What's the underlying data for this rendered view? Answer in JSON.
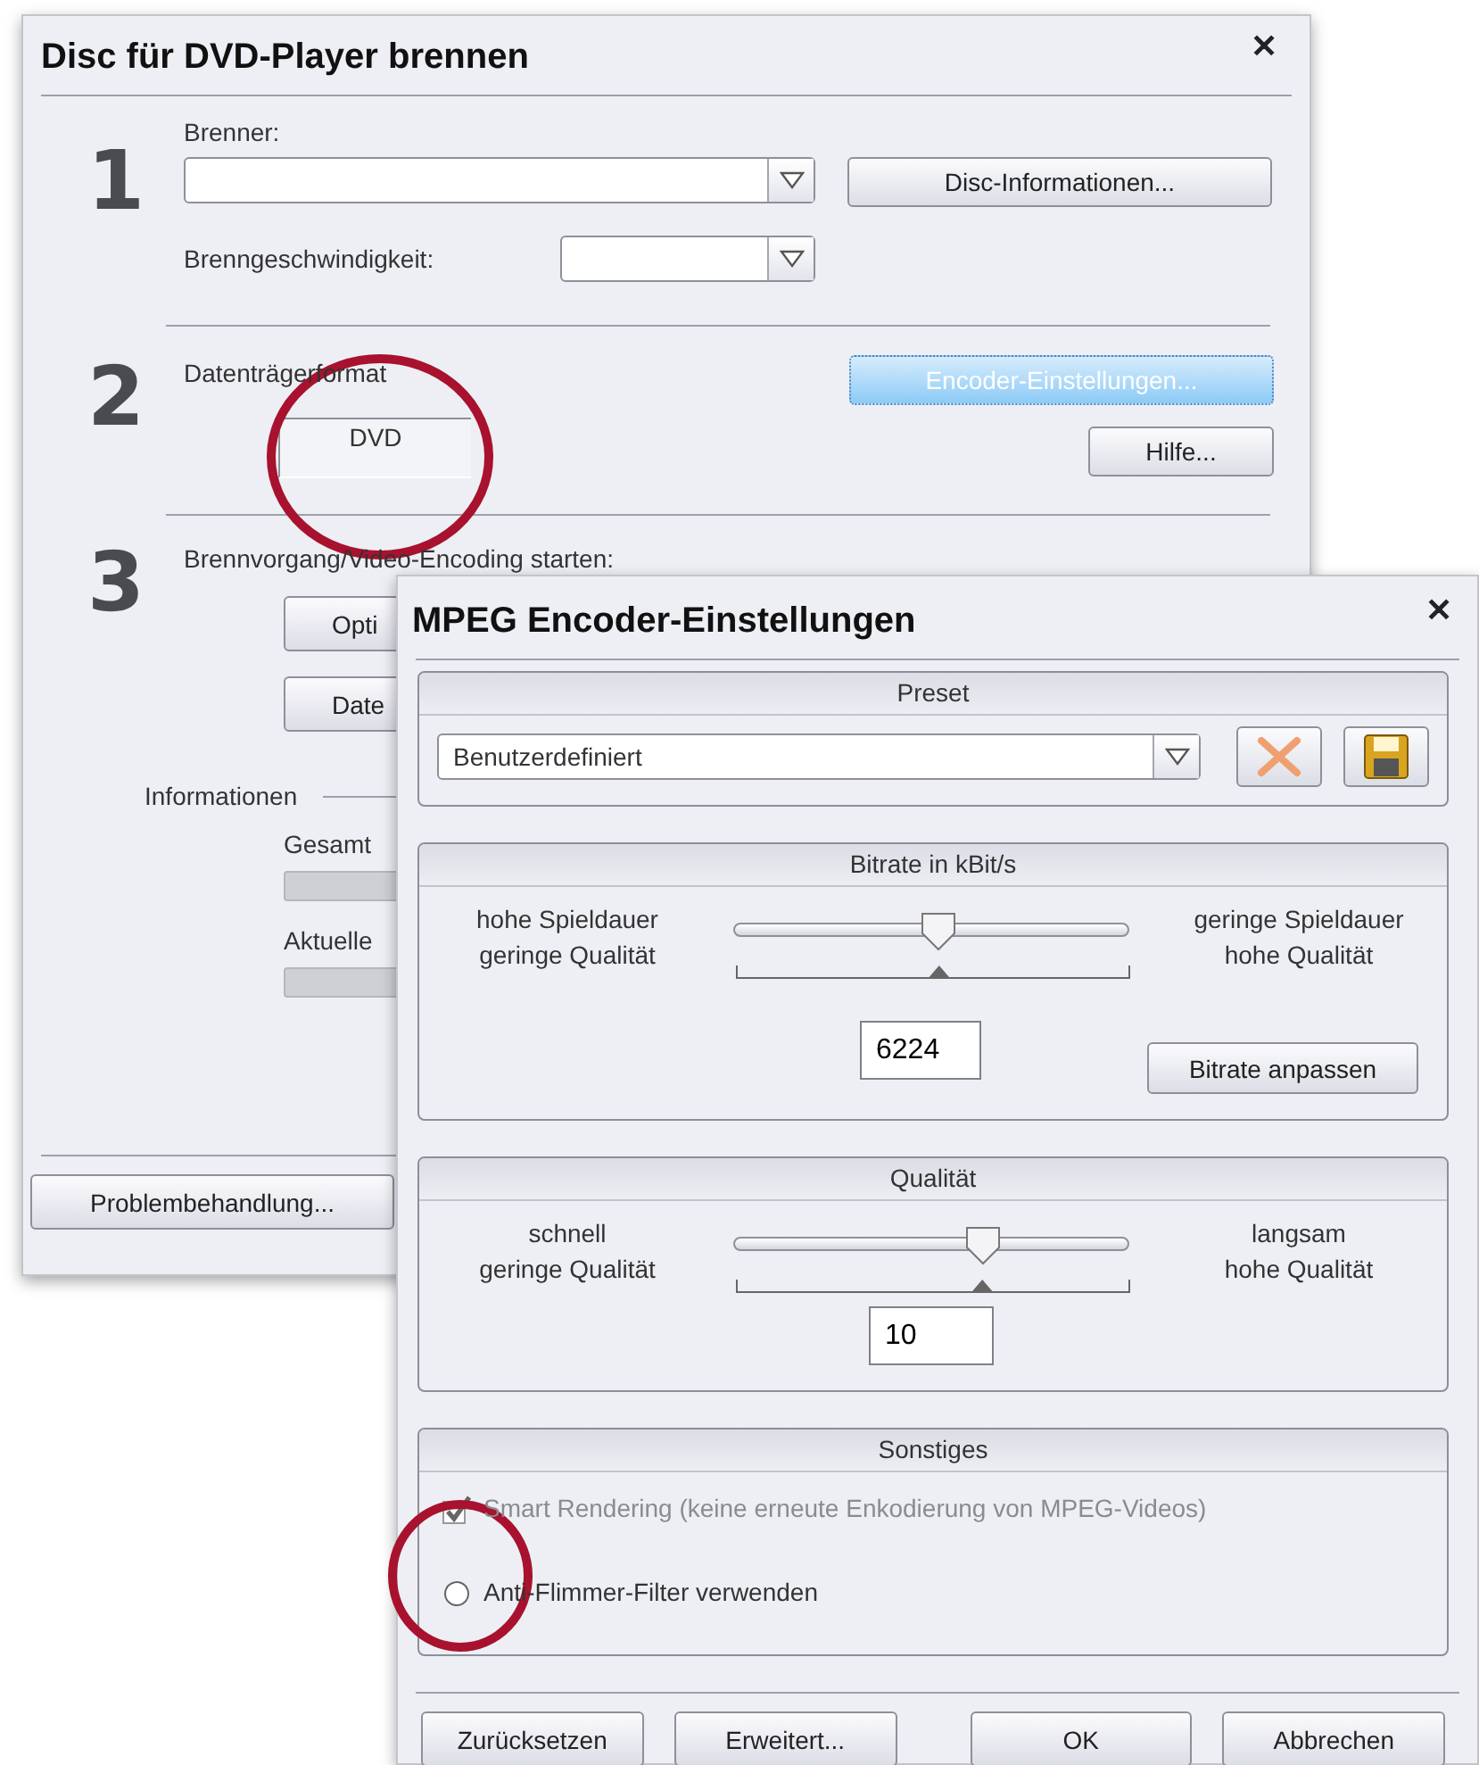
{
  "back_window": {
    "title": "Disc für DVD-Player brennen",
    "close": "✕",
    "step_1": {
      "number": "1",
      "burner_label": "Brenner:",
      "disc_info_button": "Disc-Informationen...",
      "speed_label": "Brenngeschwindigkeit:"
    },
    "step_2": {
      "number": "2",
      "format_label": "Datenträgerformat",
      "format_value": "DVD",
      "encoder_button": {
        "label": "Encoder-Einstellungen...",
        "focused": true
      },
      "help_button": "Hilfe..."
    },
    "step_3": {
      "number": "3",
      "label": "Brennvorgang/Video-Encoding starten:",
      "buttons": [
        "Opti",
        "Date"
      ],
      "info_label": "Informationen",
      "progress": [
        {
          "label": "Gesamt"
        },
        {
          "label": "Aktuelle"
        }
      ]
    },
    "troubleshoot_button": "Problembehandlung..."
  },
  "front_window": {
    "title": "MPEG Encoder-Einstellungen",
    "close": "✕",
    "preset": {
      "title": "Preset",
      "value": "Benutzerdefiniert",
      "delete_disabled": true
    },
    "bitrate": {
      "title": "Bitrate in kBit/s",
      "left_label": [
        "hohe Spieldauer",
        "geringe Qualität"
      ],
      "right_label": [
        "geringe Spieldauer",
        "hohe Qualität"
      ],
      "level": 0.52,
      "value": "6224",
      "adjust_button": "Bitrate anpassen"
    },
    "quality": {
      "title": "Qualität",
      "left_label": [
        "schnell",
        "geringe Qualität"
      ],
      "right_label": [
        "langsam",
        "hohe Qualität"
      ],
      "level": 0.63,
      "value": "10"
    },
    "other": {
      "title": "Sonstiges",
      "options": [
        {
          "kind": "checkbox",
          "label": "Smart Rendering (keine erneute Enkodierung von MPEG-Videos)",
          "checked": true,
          "disabled": true
        },
        {
          "kind": "radio",
          "label": "Anti-Flimmer-Filter verwenden",
          "checked": false,
          "disabled": false
        }
      ]
    },
    "buttons": [
      "Zurücksetzen",
      "Erweitert...",
      "OK",
      "Abbrechen"
    ]
  }
}
